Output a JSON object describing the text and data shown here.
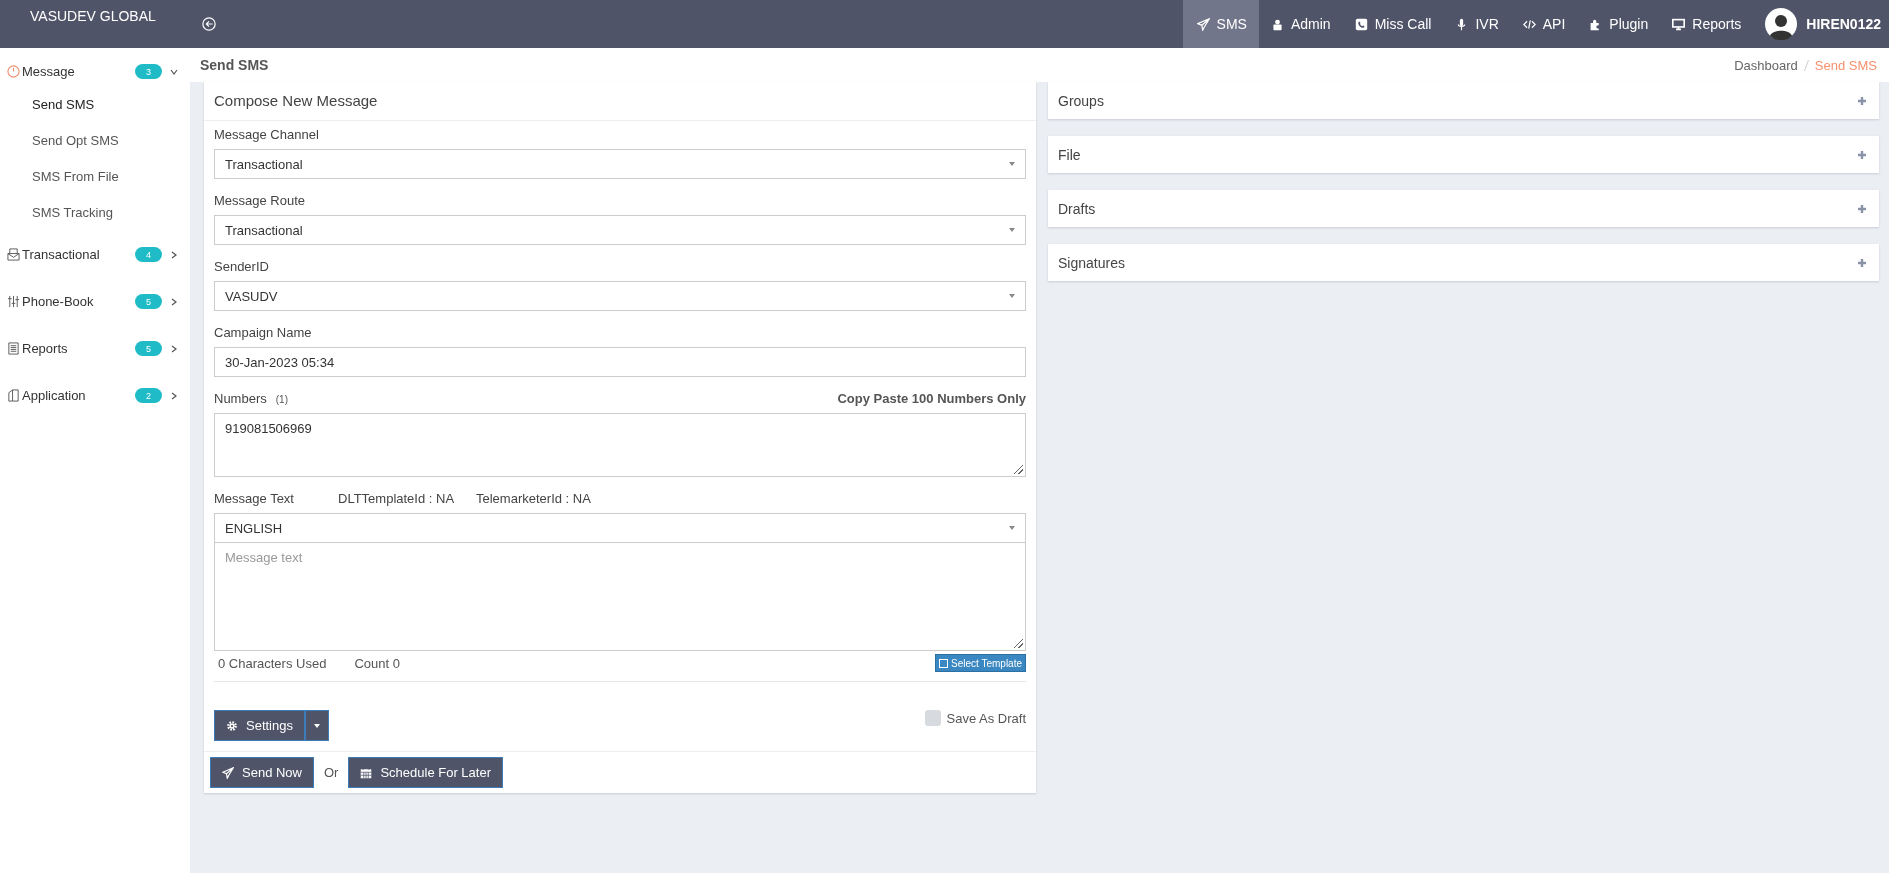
{
  "brand": "VASUDEV GLOBAL",
  "top_nav": [
    {
      "label": "SMS",
      "selected": true
    },
    {
      "label": "Admin",
      "selected": false
    },
    {
      "label": "Miss Call",
      "selected": false
    },
    {
      "label": "IVR",
      "selected": false
    },
    {
      "label": "API",
      "selected": false
    },
    {
      "label": "Plugin",
      "selected": false
    },
    {
      "label": "Reports",
      "selected": false
    }
  ],
  "user": "HIREN0122",
  "sidebar": {
    "items": [
      {
        "label": "Message",
        "badge": "3",
        "expanded": true,
        "children": [
          {
            "label": "Send SMS",
            "selected": true
          },
          {
            "label": "Send Opt SMS",
            "selected": false
          },
          {
            "label": "SMS From File",
            "selected": false
          },
          {
            "label": "SMS Tracking",
            "selected": false
          }
        ]
      },
      {
        "label": "Transactional",
        "badge": "4",
        "expanded": false
      },
      {
        "label": "Phone-Book",
        "badge": "5",
        "expanded": false
      },
      {
        "label": "Reports",
        "badge": "5",
        "expanded": false
      },
      {
        "label": "Application",
        "badge": "2",
        "expanded": false
      }
    ]
  },
  "page_title": "Send SMS",
  "breadcrumb": [
    {
      "label": "Dashboard",
      "selected": false
    },
    {
      "label": "Send SMS",
      "selected": true
    }
  ],
  "compose": {
    "title": "Compose New Message",
    "fields": [
      {
        "kind": "select",
        "label": "Message Channel",
        "value": "Transactional"
      },
      {
        "kind": "select",
        "label": "Message Route",
        "value": "Transactional"
      },
      {
        "kind": "select",
        "label": "SenderID",
        "value": "VASUDV"
      },
      {
        "kind": "input",
        "label": "Campaign Name",
        "value": "30-Jan-2023 05:34"
      }
    ],
    "numbers": {
      "label": "Numbers",
      "count": "(1)",
      "hint": "Copy Paste 100 Numbers Only",
      "value": "919081506969"
    },
    "message": {
      "label": "Message Text",
      "dlt": "DLTTemplateId : NA",
      "telemarketer": "TelemarketerId : NA",
      "language": "ENGLISH",
      "placeholder": "Message text",
      "chars": "0 Characters Used",
      "count": "Count 0",
      "template_button": "Select Template"
    },
    "settings_button": "Settings",
    "save_draft": {
      "label": "Save As Draft",
      "checked": false
    },
    "send_button": "Send Now",
    "or": "Or",
    "schedule_button": "Schedule For Later"
  },
  "panels": [
    {
      "title": "Groups",
      "expanded": false
    },
    {
      "title": "File",
      "expanded": false
    },
    {
      "title": "Drafts",
      "expanded": false
    },
    {
      "title": "Signatures",
      "expanded": false
    }
  ]
}
